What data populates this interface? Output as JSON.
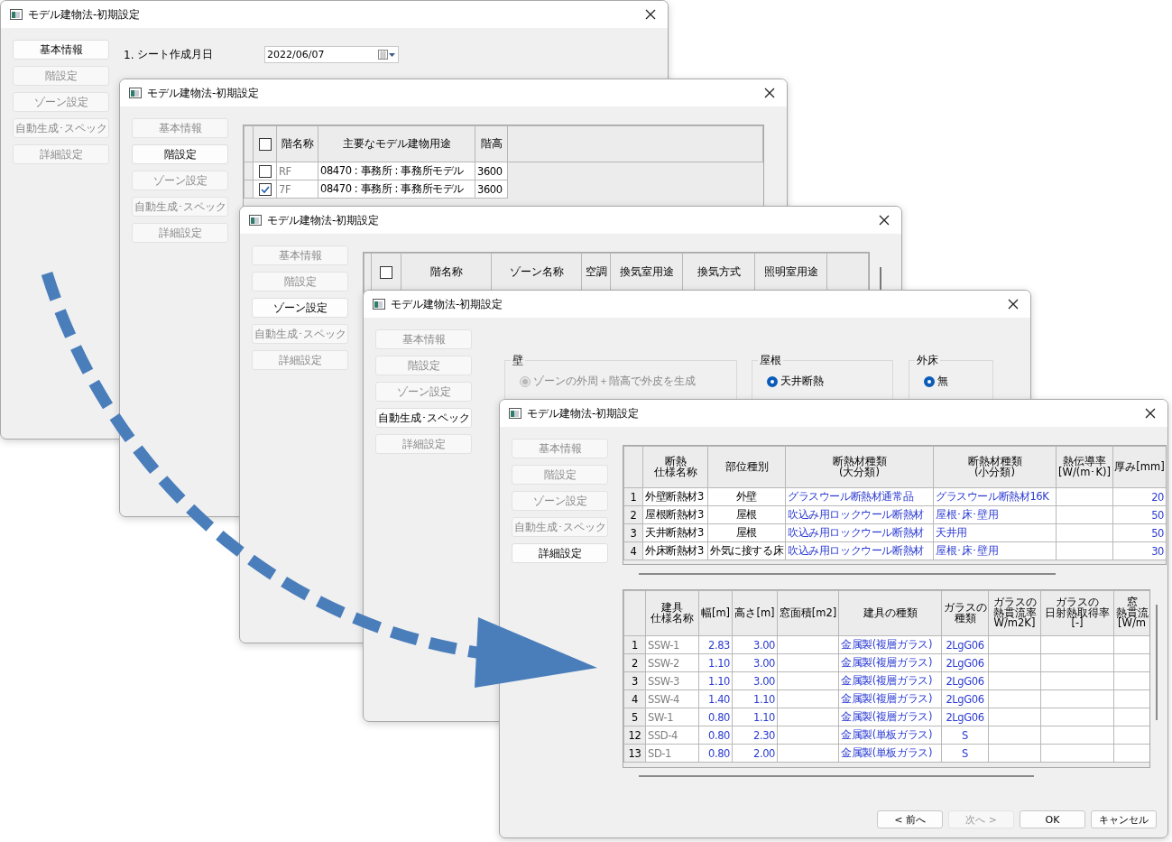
{
  "windows": [
    {
      "title": "モデル建物法-初期設定",
      "nav": [
        {
          "label": "基本情報",
          "selected": true
        },
        {
          "label": "階設定",
          "selected": false
        },
        {
          "label": "ゾーン設定",
          "selected": false
        },
        {
          "label": "自動生成･スペック",
          "selected": false
        },
        {
          "label": "詳細設定",
          "selected": false
        }
      ],
      "content": {
        "kind": "basic_info",
        "fields": [
          {
            "number": "1.",
            "label": "シート作成月日",
            "value": "2022/06/07",
            "kind": "date"
          }
        ]
      }
    },
    {
      "title": "モデル建物法-初期設定",
      "nav": [
        {
          "label": "基本情報",
          "selected": false
        },
        {
          "label": "階設定",
          "selected": true
        },
        {
          "label": "ゾーン設定",
          "selected": false
        },
        {
          "label": "自動生成･スペック",
          "selected": false
        },
        {
          "label": "詳細設定",
          "selected": false
        }
      ],
      "content": {
        "kind": "floor_table",
        "header_checked": false,
        "columns": [
          "階名称",
          "主要なモデル建物用途",
          "階高"
        ],
        "rows": [
          {
            "checked": false,
            "cells": [
              "RF",
              "08470 : 事務所 : 事務所モデル",
              "3600"
            ]
          },
          {
            "checked": true,
            "cells": [
              "7F",
              "08470 : 事務所 : 事務所モデル",
              "3600"
            ]
          }
        ]
      }
    },
    {
      "title": "モデル建物法-初期設定",
      "nav": [
        {
          "label": "基本情報",
          "selected": false
        },
        {
          "label": "階設定",
          "selected": false
        },
        {
          "label": "ゾーン設定",
          "selected": true
        },
        {
          "label": "自動生成･スペック",
          "selected": false
        },
        {
          "label": "詳細設定",
          "selected": false
        }
      ],
      "content": {
        "kind": "zone_table",
        "header_checked": false,
        "columns": [
          "階名称",
          "ゾーン名称",
          "空調",
          "換気室用途",
          "換気方式",
          "照明室用途"
        ]
      }
    },
    {
      "title": "モデル建物法-初期設定",
      "nav": [
        {
          "label": "基本情報",
          "selected": false
        },
        {
          "label": "階設定",
          "selected": false
        },
        {
          "label": "ゾーン設定",
          "selected": false
        },
        {
          "label": "自動生成･スペック",
          "selected": true
        },
        {
          "label": "詳細設定",
          "selected": false
        }
      ],
      "content": {
        "kind": "auto_spec",
        "groups": [
          {
            "label": "壁",
            "options": [
              {
                "label": "ゾーンの外周＋階高で外皮を生成",
                "selected": true,
                "disabled": true
              }
            ]
          },
          {
            "label": "屋根",
            "options": [
              {
                "label": "天井断熱",
                "selected": true,
                "disabled": false
              }
            ]
          },
          {
            "label": "外床",
            "options": [
              {
                "label": "無",
                "selected": true,
                "disabled": false
              }
            ]
          }
        ]
      }
    },
    {
      "title": "モデル建物法-初期設定",
      "nav": [
        {
          "label": "基本情報",
          "selected": false
        },
        {
          "label": "階設定",
          "selected": false
        },
        {
          "label": "ゾーン設定",
          "selected": false
        },
        {
          "label": "自動生成･スペック",
          "selected": false
        },
        {
          "label": "詳細設定",
          "selected": true
        }
      ],
      "content": {
        "kind": "detail",
        "tables": [
          {
            "columns": [
              {
                "label": [
                  "断熱",
                  "仕様名称"
                ],
                "kind": "text"
              },
              {
                "label": [
                  "部位種別"
                ],
                "kind": "center"
              },
              {
                "label": [
                  "断熱材種類",
                  "(大分類)"
                ],
                "kind": "link"
              },
              {
                "label": [
                  "断熱材種類",
                  "(小分類)"
                ],
                "kind": "link"
              },
              {
                "label": [
                  "熱伝導率",
                  "[W/(m･K)]"
                ]
              },
              {
                "label": [
                  "厚み[mm]"
                ],
                "kind": "link_number"
              }
            ],
            "rows": [
              {
                "number": "1",
                "cells": [
                  "外壁断熱材3",
                  "外壁",
                  "グラスウール断熱材通常品",
                  "グラスウール断熱材16K",
                  null,
                  "20"
                ]
              },
              {
                "number": "2",
                "cells": [
                  "屋根断熱材3",
                  "屋根",
                  "吹込み用ロックウール断熱材",
                  "屋根･床･壁用",
                  null,
                  "50"
                ]
              },
              {
                "number": "3",
                "cells": [
                  "天井断熱材3",
                  "屋根",
                  "吹込み用ロックウール断熱材",
                  "天井用",
                  null,
                  "50"
                ]
              },
              {
                "number": "4",
                "cells": [
                  "外床断熱材3",
                  "外気に接する床",
                  "吹込み用ロックウール断熱材",
                  "屋根･床･壁用",
                  null,
                  "30"
                ]
              }
            ]
          },
          {
            "columns": [
              {
                "label": [
                  "建具",
                  "仕様名称"
                ],
                "kind": "dim"
              },
              {
                "label": [
                  "幅[m]"
                ],
                "kind": "link_number"
              },
              {
                "label": [
                  "高さ[m]"
                ],
                "kind": "link_number"
              },
              {
                "label": [
                  "窓面積[m2]"
                ]
              },
              {
                "label": [
                  "建具の種類"
                ],
                "kind": "link"
              },
              {
                "label": [
                  "ガラスの",
                  "種類"
                ],
                "kind": "link_center"
              },
              {
                "label": [
                  "ガラスの",
                  "熱貫流率",
                  "W/m2K]"
                ]
              },
              {
                "label": [
                  "ガラスの",
                  "日射熱取得率",
                  "[-]"
                ]
              },
              {
                "label": [
                  "窓",
                  "熱貫流",
                  "[W/m"
                ]
              }
            ],
            "rows": [
              {
                "number": "1",
                "cells": [
                  "SSW-1",
                  "2.83",
                  "3.00",
                  null,
                  "金属製(複層ガラス)",
                  "2LgG06",
                  null,
                  null,
                  null
                ]
              },
              {
                "number": "2",
                "cells": [
                  "SSW-2",
                  "1.10",
                  "3.00",
                  null,
                  "金属製(複層ガラス)",
                  "2LgG06",
                  null,
                  null,
                  null
                ]
              },
              {
                "number": "3",
                "cells": [
                  "SSW-3",
                  "1.10",
                  "3.00",
                  null,
                  "金属製(複層ガラス)",
                  "2LgG06",
                  null,
                  null,
                  null
                ]
              },
              {
                "number": "4",
                "cells": [
                  "SSW-4",
                  "1.40",
                  "1.10",
                  null,
                  "金属製(複層ガラス)",
                  "2LgG06",
                  null,
                  null,
                  null
                ]
              },
              {
                "number": "5",
                "cells": [
                  "SW-1",
                  "0.80",
                  "1.10",
                  null,
                  "金属製(複層ガラス)",
                  "2LgG06",
                  null,
                  null,
                  null
                ]
              },
              {
                "number": "12",
                "cells": [
                  "SSD-4",
                  "0.80",
                  "2.30",
                  null,
                  "金属製(単板ガラス)",
                  "S",
                  null,
                  null,
                  null
                ]
              },
              {
                "number": "13",
                "cells": [
                  "SD-1",
                  "0.80",
                  "2.00",
                  null,
                  "金属製(単板ガラス)",
                  "S",
                  null,
                  null,
                  null
                ]
              }
            ]
          }
        ]
      },
      "buttons": [
        {
          "label": "< 前へ",
          "disabled": false
        },
        {
          "label": "次へ >",
          "disabled": true
        },
        {
          "label": "OK",
          "disabled": false
        },
        {
          "label": "キャンセル",
          "disabled": false
        }
      ]
    }
  ]
}
